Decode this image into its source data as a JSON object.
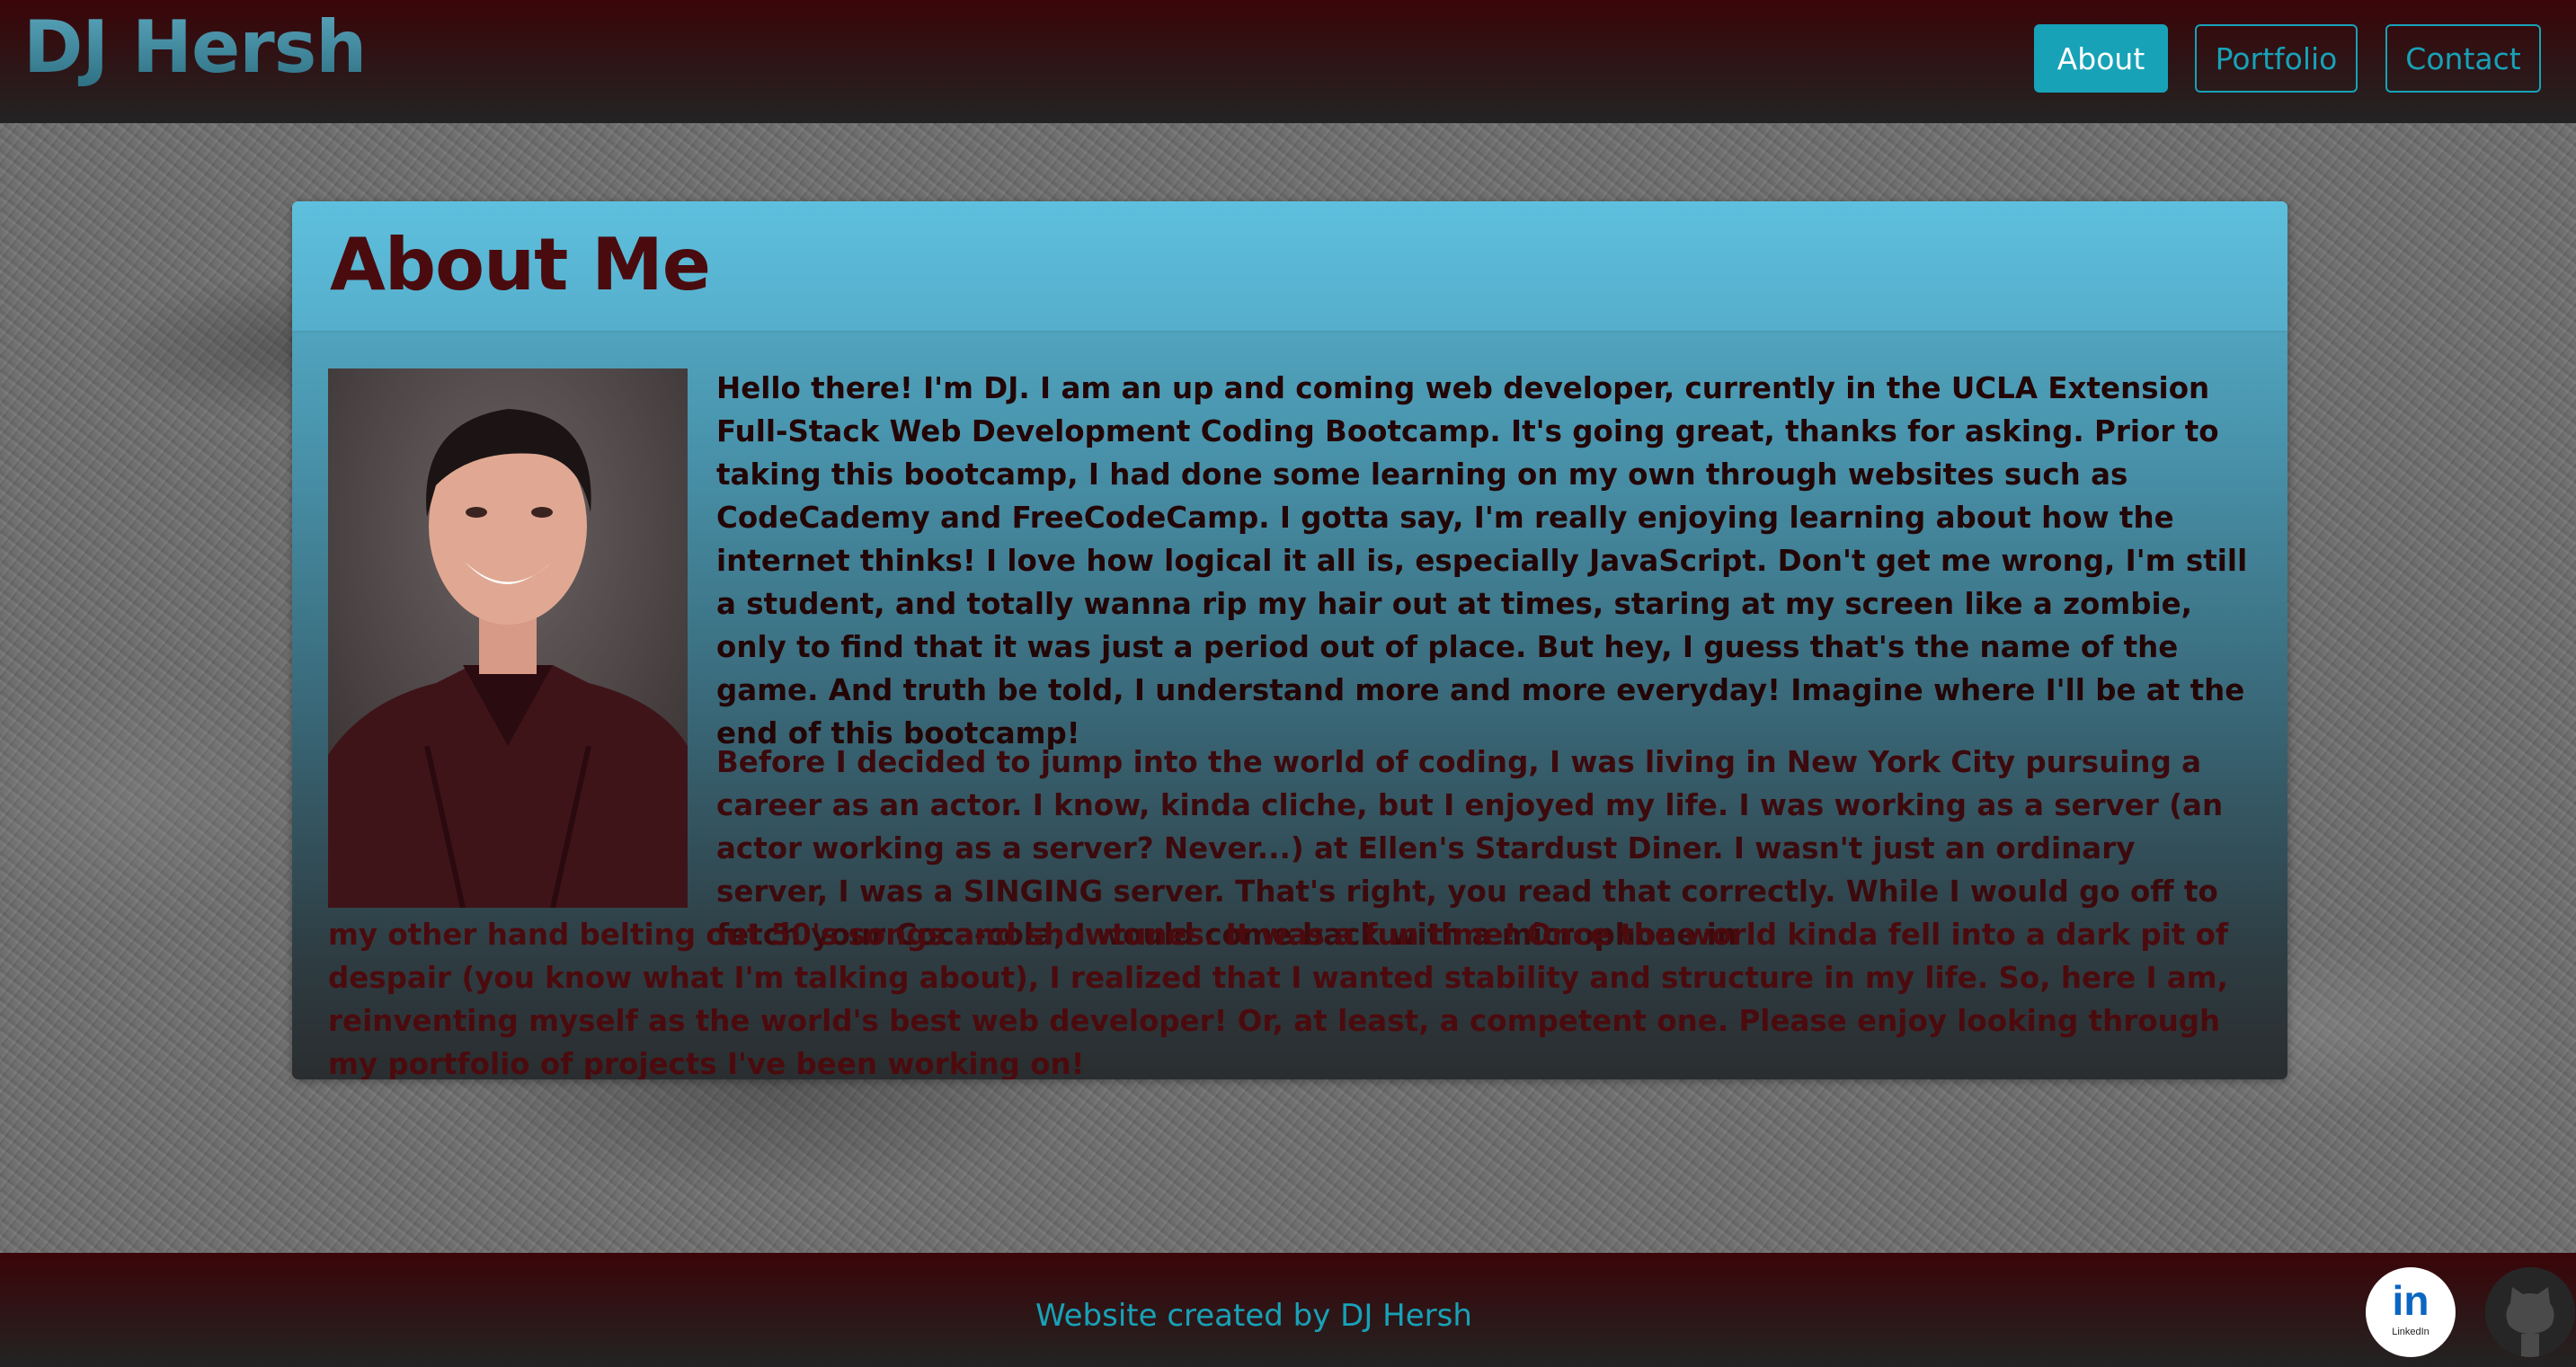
{
  "header": {
    "brand": "DJ Hersh",
    "nav": [
      {
        "label": "About",
        "active": true
      },
      {
        "label": "Portfolio",
        "active": false
      },
      {
        "label": "Contact",
        "active": false
      }
    ]
  },
  "about": {
    "title": "About Me",
    "paragraph1": "Hello there! I'm DJ. I am an up and coming web developer, currently in the UCLA Extension Full-Stack Web Development Coding Bootcamp. It's going great, thanks for asking. Prior to taking this bootcamp, I had done some learning on my own through websites such as CodeCademy and FreeCodeCamp. I gotta say, I'm really enjoying learning about how the internet thinks! I love how logical it all is, especially JavaScript. Don't get me wrong, I'm still a student, and totally wanna rip my hair out at times, staring at my screen like a zombie, only to find that it was just a period out of place. But hey, I guess that's the name of the game. And truth be told, I understand more and more everyday! Imagine where I'll be at the end of this bootcamp!",
    "paragraph2a": "Before I decided to jump into the world of coding, I was living in New York City pursuing a career as an actor. I know, kinda cliche, but I enjoyed my life. I was working as a server (an actor working as a server? Never...) at Ellen's Stardust Diner. I wasn't just an ordinary server, I was a SINGING server. That's right, you read that correctly. While I would go off to fetch your Coca-cola, I would come back with a microphone in",
    "paragraph2b": "my other hand belting out 50's songs and showtunes. It was a fun time! Once the world kinda fell into a dark pit of despair (you know what I'm talking about), I realized that I wanted stability and structure in my life. So, here I am, reinventing myself as the world's best web developer! Or, at least, a competent one. Please enjoy looking through my portfolio of projects I've been working on!"
  },
  "footer": {
    "credit": "Website created by DJ Hersh",
    "linkedin_text": "in",
    "linkedin_caption": "LinkedIn"
  },
  "colors": {
    "accent": "#17a2b8",
    "header_top": "#3a0508",
    "card_top": "#5ab5d3",
    "text_dark_red": "#3f080b"
  },
  "icons": {
    "linkedin": "linkedin-icon",
    "github": "github-icon"
  }
}
